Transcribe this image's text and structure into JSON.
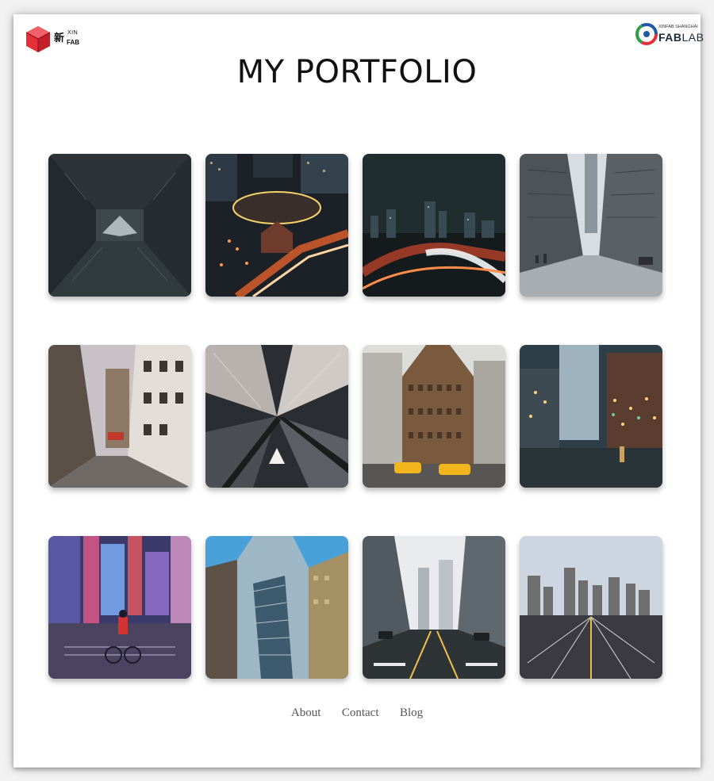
{
  "logos": {
    "left": {
      "cn": "新",
      "xin": "XIN",
      "fab": "FAB"
    },
    "right": {
      "small": "XINFAB SHANGHAI",
      "fab": "FAB",
      "lab": "LAB"
    }
  },
  "page_title": "MY PORTFOLIO",
  "gallery": [
    {
      "name": "photo-tunnel-looking-up",
      "scene": "tunnel"
    },
    {
      "name": "photo-night-intersection-lights",
      "scene": "night-plaza"
    },
    {
      "name": "photo-night-skyline-highway",
      "scene": "night-highway"
    },
    {
      "name": "photo-avenue-skyscrapers",
      "scene": "avenue"
    },
    {
      "name": "photo-parisian-street",
      "scene": "paris"
    },
    {
      "name": "photo-aerial-skyscrapers",
      "scene": "aerial"
    },
    {
      "name": "photo-flatiron-taxis",
      "scene": "flatiron"
    },
    {
      "name": "photo-evening-street-lights",
      "scene": "evening"
    },
    {
      "name": "photo-cyclist-neon-blur",
      "scene": "neon"
    },
    {
      "name": "photo-glass-towers-looking-up",
      "scene": "glass"
    },
    {
      "name": "photo-foggy-street",
      "scene": "fog"
    },
    {
      "name": "photo-road-to-skyline",
      "scene": "road"
    }
  ],
  "footer": {
    "links": [
      "About",
      "Contact",
      "Blog"
    ]
  },
  "colors": {
    "brand_red": "#e63039",
    "footer_text": "#555555"
  }
}
